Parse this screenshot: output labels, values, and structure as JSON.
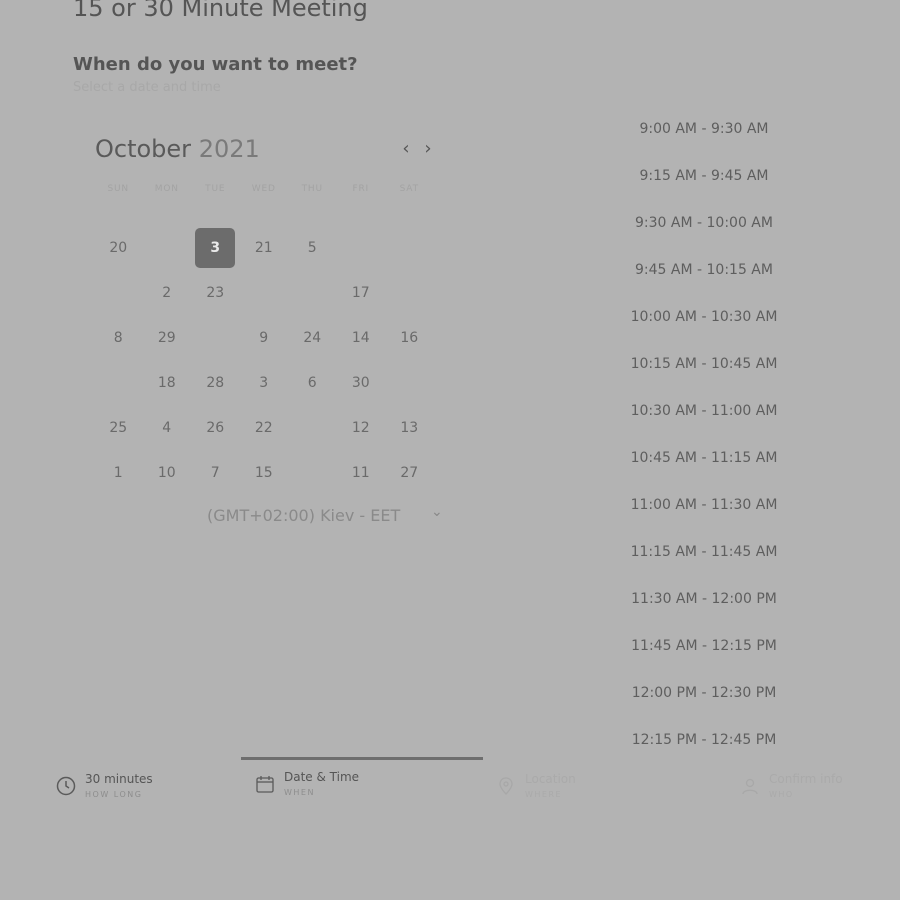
{
  "title": "15 or 30 Minute Meeting",
  "question": "When do you want to meet?",
  "subtitle": "Select a date and time",
  "calendar": {
    "month": "October",
    "year": "2021",
    "prev_icon": "chevron-left-icon",
    "next_icon": "chevron-right-icon",
    "weekdays": [
      "SUN",
      "MON",
      "TUE",
      "WED",
      "THU",
      "FRI",
      "SAT"
    ],
    "weeks": [
      [
        "20",
        "",
        "3",
        "21",
        "5",
        "",
        ""
      ],
      [
        "",
        "2",
        "23",
        "",
        "",
        "17",
        ""
      ],
      [
        "8",
        "29",
        "",
        "9",
        "24",
        "14",
        "16"
      ],
      [
        "",
        "18",
        "28",
        "3",
        "6",
        "30",
        ""
      ],
      [
        "25",
        "4",
        "26",
        "22",
        "",
        "12",
        "13"
      ],
      [
        "1",
        "10",
        "7",
        "15",
        "",
        "11",
        "27"
      ]
    ],
    "selected_day": "3"
  },
  "timezone": {
    "label": "(GMT+02:00) Kiev - EET",
    "icon": "chevron-down-icon"
  },
  "time_slots": [
    "9:00 AM - 9:30 AM",
    "9:15 AM - 9:45 AM",
    "9:30 AM - 10:00 AM",
    "9:45 AM - 10:15 AM",
    "10:00 AM - 10:30 AM",
    "10:15 AM - 10:45 AM",
    "10:30 AM - 11:00 AM",
    "10:45 AM - 11:15 AM",
    "11:00 AM - 11:30 AM",
    "11:15 AM - 11:45 AM",
    "11:30 AM - 12:00 PM",
    "11:45 AM - 12:15 PM",
    "12:00 PM - 12:30 PM",
    "12:15 PM - 12:45 PM"
  ],
  "steps": [
    {
      "label": "30 minutes",
      "sub": "HOW LONG",
      "icon": "clock-icon"
    },
    {
      "label": "Date & Time",
      "sub": "WHEN",
      "icon": "calendar-icon"
    },
    {
      "label": "Location",
      "sub": "WHERE",
      "icon": "location-icon"
    },
    {
      "label": "Confirm info",
      "sub": "WHO",
      "icon": "user-icon"
    }
  ]
}
